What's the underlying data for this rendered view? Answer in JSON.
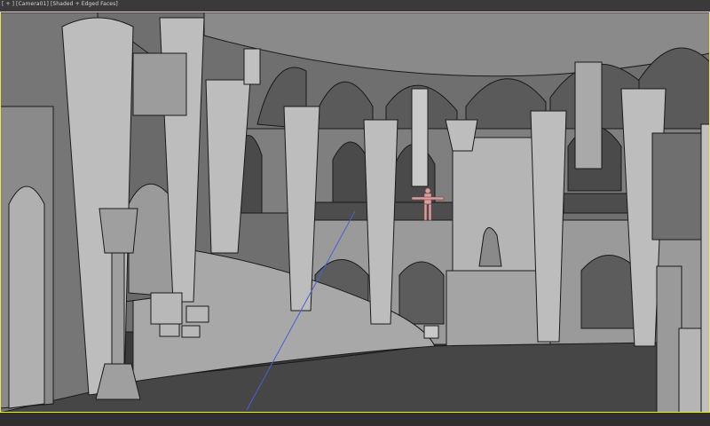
{
  "viewport": {
    "label_plus": "[ + ]",
    "label_camera": "[Camera01]",
    "label_shading": "[Shaded + Edged Faces]"
  },
  "colors": {
    "frame": "#e5e55e",
    "background": "#3a3a3a",
    "wall": "#8e8e8e",
    "wall_dark": "#5c5c5c",
    "column": "#b9b9b9",
    "edge": "#1a1a1a",
    "floor": "#454545",
    "character": "#d9a0a0",
    "camera_line": "#4a5fd6"
  }
}
